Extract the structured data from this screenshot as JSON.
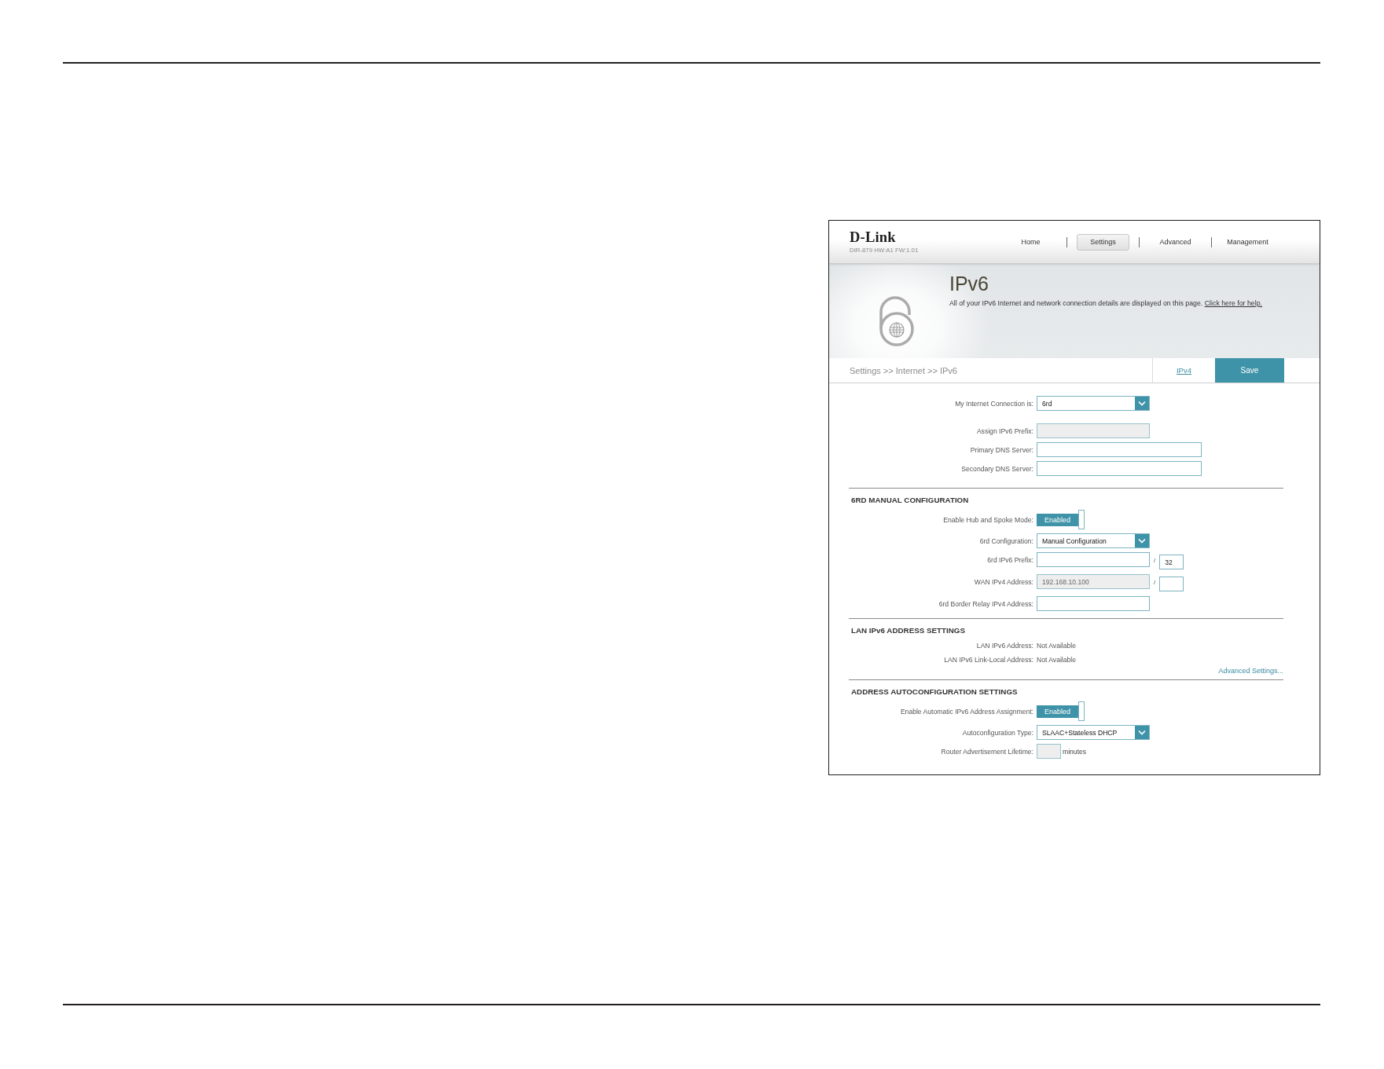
{
  "header": {
    "logo": "D-Link",
    "model": "DIR-879 HW:A1 FW:1.01",
    "nav": [
      {
        "label": "Home",
        "selected": false
      },
      {
        "label": "Settings",
        "selected": true
      },
      {
        "label": "Advanced",
        "selected": false
      },
      {
        "label": "Management",
        "selected": false
      }
    ]
  },
  "hero": {
    "title": "IPv6",
    "description": "All of your IPv6 Internet and network connection details are displayed on this page.",
    "help_link": "Click here for help."
  },
  "toolbar": {
    "breadcrumb": "Settings >> Internet >> IPv6",
    "link": "IPv4",
    "save": "Save"
  },
  "sections": [
    {
      "rows": [
        {
          "kind": "select",
          "label": "My Internet Connection is:",
          "value": "6rd"
        },
        {
          "kind": "input",
          "label": "Assign IPv6 Prefix:",
          "disabled": true
        },
        {
          "kind": "input",
          "label": "Primary DNS Server:",
          "disabled": false
        },
        {
          "kind": "input",
          "label": "Secondary DNS Server:",
          "disabled": false
        }
      ]
    },
    {
      "heading": "6RD MANUAL CONFIGURATION",
      "rows": [
        {
          "kind": "toggle",
          "label": "Enable Hub and Spoke Mode:",
          "value": "Enabled",
          "on": true
        },
        {
          "kind": "select",
          "label": "6rd Configuration:",
          "value": "Manual Configuration"
        },
        {
          "kind": "input",
          "label": "6rd IPv6 Prefix:",
          "disabled": false,
          "separator": "/",
          "length": {
            "value": "32",
            "disabled": false
          }
        },
        {
          "kind": "input",
          "label": "WAN IPv4 Address:",
          "value": "192.168.10.100",
          "disabled": true,
          "separator": "/",
          "length": {
            "disabled": false
          }
        },
        {
          "kind": "input",
          "label": "6rd Border Relay IPv4 Address:",
          "disabled": false
        }
      ]
    },
    {
      "heading": "LAN IPv6 ADDRESS SETTINGS",
      "rows": [
        {
          "kind": "text",
          "label": "LAN IPv6 Address:",
          "value": "Not Available"
        },
        {
          "kind": "text",
          "label": "LAN IPv6 Link-Local Address:",
          "value": "Not Available"
        }
      ],
      "link": "Advanced Settings..."
    },
    {
      "heading": "ADDRESS AUTOCONFIGURATION SETTINGS",
      "rows": [
        {
          "kind": "toggle",
          "label": "Enable Automatic IPv6 Address Assignment:",
          "value": "Enabled",
          "on": true
        },
        {
          "kind": "select",
          "label": "Autoconfiguration Type:",
          "value": "SLAAC+Stateless DHCP"
        },
        {
          "kind": "input",
          "label": "Router Advertisement Lifetime:",
          "disabled": true,
          "unit": "minutes"
        }
      ]
    }
  ]
}
